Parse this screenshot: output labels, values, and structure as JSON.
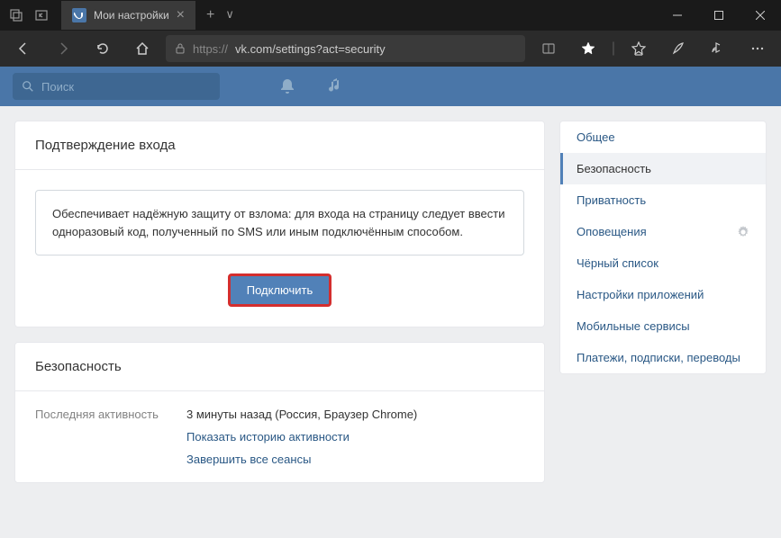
{
  "browser": {
    "tab_title": "Мои настройки",
    "url_proto": "https://",
    "url": "vk.com/settings?act=security"
  },
  "vk_header": {
    "search_placeholder": "Поиск"
  },
  "card_2fa": {
    "title": "Подтверждение входа",
    "description": "Обеспечивает надёжную защиту от взлома: для входа на страницу следует ввести одноразовый код, полученный по SMS или иным подключённым способом.",
    "button": "Подключить"
  },
  "card_security": {
    "title": "Безопасность",
    "last_activity_label": "Последняя активность",
    "last_activity_value": "3 минуты назад (Россия, Браузер Chrome)",
    "show_history": "Показать историю активности",
    "end_sessions": "Завершить все сеансы"
  },
  "sidebar": {
    "items": [
      {
        "label": "Общее"
      },
      {
        "label": "Безопасность"
      },
      {
        "label": "Приватность"
      },
      {
        "label": "Оповещения"
      },
      {
        "label": "Чёрный список"
      },
      {
        "label": "Настройки приложений"
      },
      {
        "label": "Мобильные сервисы"
      },
      {
        "label": "Платежи, подписки, переводы"
      }
    ],
    "active_index": 1
  }
}
